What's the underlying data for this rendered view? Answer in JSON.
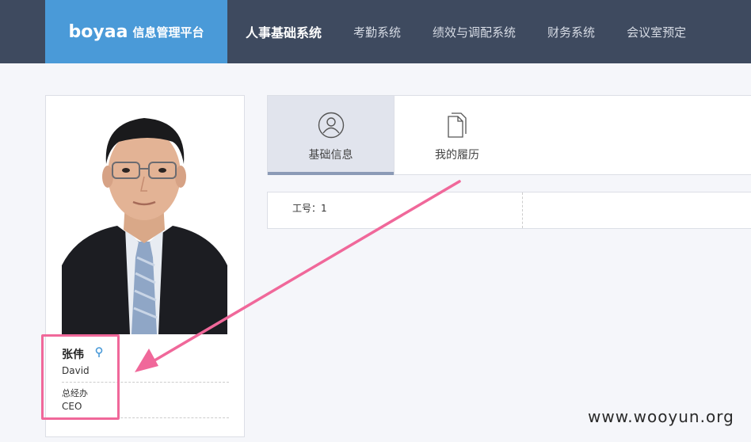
{
  "brand": {
    "logo": "boyaa",
    "name": "信息管理平台"
  },
  "nav": [
    {
      "label": "人事基础系统",
      "active": true
    },
    {
      "label": "考勤系统"
    },
    {
      "label": "绩效与调配系统"
    },
    {
      "label": "财务系统"
    },
    {
      "label": "会议室预定"
    }
  ],
  "profile": {
    "name": "张伟",
    "english_name": "David",
    "department": "总经办",
    "title": "CEO"
  },
  "tabs": [
    {
      "label": "基础信息",
      "icon": "user-icon"
    },
    {
      "label": "我的履历",
      "icon": "documents-icon"
    }
  ],
  "info": {
    "employee_id": "工号：1"
  },
  "watermark": "www.wooyun.org",
  "colors": {
    "topbar": "#3e4a5f",
    "brand": "#4a9ad8",
    "annotation": "#f0689a"
  }
}
